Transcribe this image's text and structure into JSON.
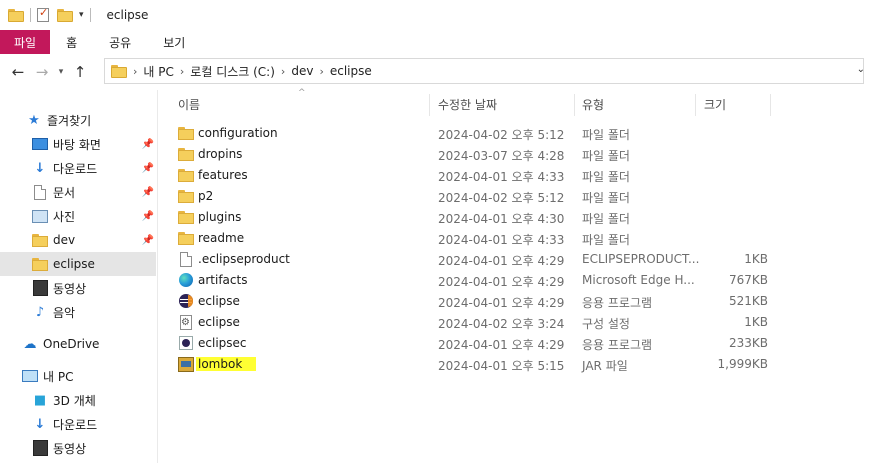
{
  "window": {
    "title": "eclipse"
  },
  "ribbon": {
    "tabs": [
      "파일",
      "홈",
      "공유",
      "보기"
    ]
  },
  "address": {
    "crumbs": [
      "내 PC",
      "로컬 디스크 (C:)",
      "dev",
      "eclipse"
    ]
  },
  "nav": {
    "quick_access": "즐겨찾기",
    "items": [
      {
        "label": "바탕 화면",
        "icon": "desktop-icon",
        "pinned": true
      },
      {
        "label": "다운로드",
        "icon": "download-icon",
        "pinned": true
      },
      {
        "label": "문서",
        "icon": "document-icon",
        "pinned": true
      },
      {
        "label": "사진",
        "icon": "pictures-icon",
        "pinned": true
      },
      {
        "label": "dev",
        "icon": "folder-icon",
        "pinned": true
      },
      {
        "label": "eclipse",
        "icon": "folder-icon",
        "pinned": false,
        "selected": true
      },
      {
        "label": "동영상",
        "icon": "video-icon",
        "pinned": false
      },
      {
        "label": "음악",
        "icon": "music-icon",
        "pinned": false
      }
    ],
    "onedrive": "OneDrive",
    "this_pc": "내 PC",
    "pc_items": [
      {
        "label": "3D 개체",
        "icon": "3d-objects-icon"
      },
      {
        "label": "다운로드",
        "icon": "download-icon"
      },
      {
        "label": "동영상",
        "icon": "video-icon"
      }
    ]
  },
  "columns": {
    "name": "이름",
    "date": "수정한 날짜",
    "type": "유형",
    "size": "크기"
  },
  "files": [
    {
      "name": "configuration",
      "date": "2024-04-02 오후 5:12",
      "type": "파일 폴더",
      "size": "",
      "icon": "folder-icon"
    },
    {
      "name": "dropins",
      "date": "2024-03-07 오후 4:28",
      "type": "파일 폴더",
      "size": "",
      "icon": "folder-icon"
    },
    {
      "name": "features",
      "date": "2024-04-01 오후 4:33",
      "type": "파일 폴더",
      "size": "",
      "icon": "folder-icon"
    },
    {
      "name": "p2",
      "date": "2024-04-02 오후 5:12",
      "type": "파일 폴더",
      "size": "",
      "icon": "folder-icon"
    },
    {
      "name": "plugins",
      "date": "2024-04-01 오후 4:30",
      "type": "파일 폴더",
      "size": "",
      "icon": "folder-icon"
    },
    {
      "name": "readme",
      "date": "2024-04-01 오후 4:33",
      "type": "파일 폴더",
      "size": "",
      "icon": "folder-icon"
    },
    {
      "name": ".eclipseproduct",
      "date": "2024-04-01 오후 4:29",
      "type": "ECLIPSEPRODUCT...",
      "size": "1KB",
      "icon": "blank-file-icon"
    },
    {
      "name": "artifacts",
      "date": "2024-04-01 오후 4:29",
      "type": "Microsoft Edge H...",
      "size": "767KB",
      "icon": "edge-icon"
    },
    {
      "name": "eclipse",
      "date": "2024-04-01 오후 4:29",
      "type": "응용 프로그램",
      "size": "521KB",
      "icon": "eclipse-icon"
    },
    {
      "name": "eclipse",
      "date": "2024-04-02 오후 3:24",
      "type": "구성 설정",
      "size": "1KB",
      "icon": "config-file-icon"
    },
    {
      "name": "eclipsec",
      "date": "2024-04-01 오후 4:29",
      "type": "응용 프로그램",
      "size": "233KB",
      "icon": "eclipsec-icon"
    },
    {
      "name": "lombok",
      "date": "2024-04-01 오후 5:15",
      "type": "JAR 파일",
      "size": "1,999KB",
      "icon": "jar-icon",
      "highlighted": true
    }
  ],
  "colors": {
    "file_tab": "#c2185b",
    "highlight": "#ffff33",
    "selected_nav": "#e5e5e5"
  }
}
